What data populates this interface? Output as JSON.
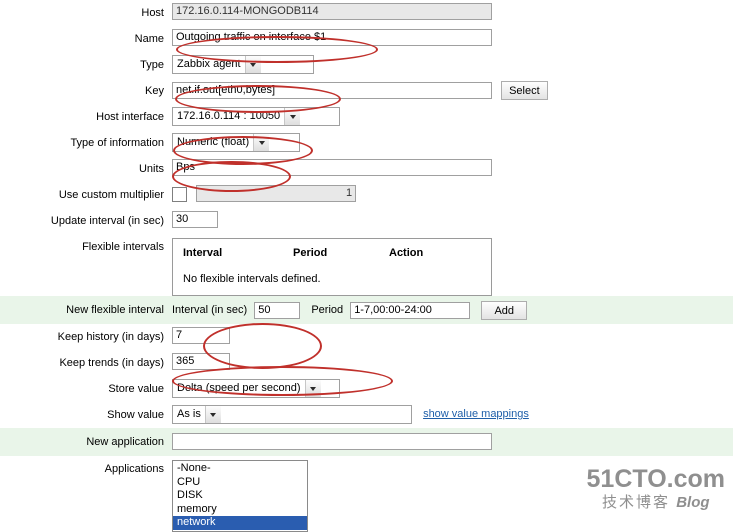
{
  "form": {
    "rows": [
      {
        "label": "Host",
        "value": "172.16.0.114-MONGODB114"
      },
      {
        "label": "Name",
        "value": "Outgoing traffic on interface $1"
      },
      {
        "label": "Type",
        "value": "Zabbix agent"
      },
      {
        "label": "Key",
        "value": "net.if.out[eth0,bytes]",
        "button": "Select"
      },
      {
        "label": "Host interface",
        "value": "172.16.0.114 : 10050"
      },
      {
        "label": "Type of information",
        "value": "Numeric (float)"
      },
      {
        "label": "Units",
        "value": "Bps"
      },
      {
        "label": "Use custom multiplier",
        "value": "1"
      },
      {
        "label": "Update interval (in sec)",
        "value": "30"
      },
      {
        "label": "Flexible intervals"
      },
      {
        "label": "New flexible interval"
      },
      {
        "label": "Keep history (in days)",
        "value": "7"
      },
      {
        "label": "Keep trends (in days)",
        "value": "365"
      },
      {
        "label": "Store value",
        "value": "Delta (speed per second)"
      },
      {
        "label": "Show value",
        "value": "As is"
      },
      {
        "label": "New application",
        "value": ""
      },
      {
        "label": "Applications"
      }
    ],
    "flexible_intervals": {
      "columns": [
        "Interval",
        "Period",
        "Action"
      ],
      "empty_text": "No flexible intervals defined."
    },
    "new_flexible_interval": {
      "interval_label": "Interval (in sec)",
      "interval_value": "50",
      "period_label": "Period",
      "period_value": "1-7,00:00-24:00",
      "add_button": "Add"
    },
    "show_value_link": "show value mappings",
    "applications": {
      "options": [
        "-None-",
        "CPU",
        "DISK",
        "memory",
        "network"
      ],
      "selected": "network"
    }
  },
  "watermark": {
    "line1": "51CTO.com",
    "line2": "技术博客",
    "line2_suffix": "Blog"
  }
}
